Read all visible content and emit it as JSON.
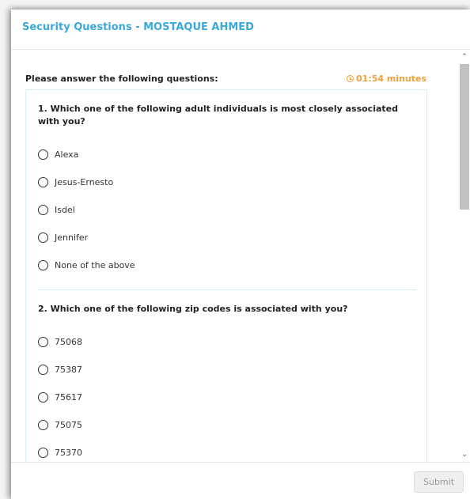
{
  "modal": {
    "title": "Security Questions - MOSTAQUE AHMED",
    "intro": "Please answer the following questions:",
    "timer": "01:54 minutes",
    "accent_color": "#3aa8d8",
    "timer_color": "#f0a03c"
  },
  "questions": [
    {
      "text": "1. Which one of the following adult individuals is most closely associated with you?",
      "options": [
        "Alexa",
        "Jesus-Ernesto",
        "Isdel",
        "Jennifer",
        "None of the above"
      ]
    },
    {
      "text": "2. Which one of the following zip codes is associated with you?",
      "options": [
        "75068",
        "75387",
        "75617",
        "75075",
        "75370"
      ]
    }
  ],
  "scrollbar": {
    "up_icon": "chevron-up-icon",
    "down_icon": "chevron-down-icon"
  },
  "footer": {
    "submit_label": "Submit"
  }
}
